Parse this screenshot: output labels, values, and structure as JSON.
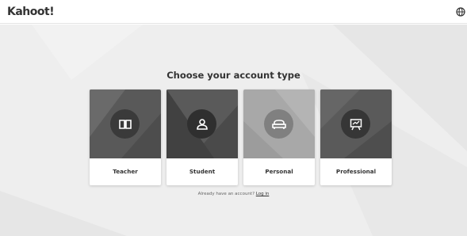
{
  "header": {
    "logo": "Kahoot!",
    "language_icon": "globe-icon"
  },
  "main": {
    "title": "Choose your account type",
    "cards": [
      {
        "label": "Teacher",
        "icon": "book-icon",
        "color": "#555555"
      },
      {
        "label": "Student",
        "icon": "person-icon",
        "color": "#4a4a4a"
      },
      {
        "label": "Personal",
        "icon": "sofa-icon",
        "color": "#a6a6a6"
      },
      {
        "label": "Professional",
        "icon": "presentation-board-icon",
        "color": "#585858"
      }
    ],
    "signin_prompt": "Already have an account?",
    "signin_link": "Log in"
  },
  "colors": {
    "background": "#eeeeee",
    "header_bg": "#ffffff",
    "text": "#333333"
  }
}
